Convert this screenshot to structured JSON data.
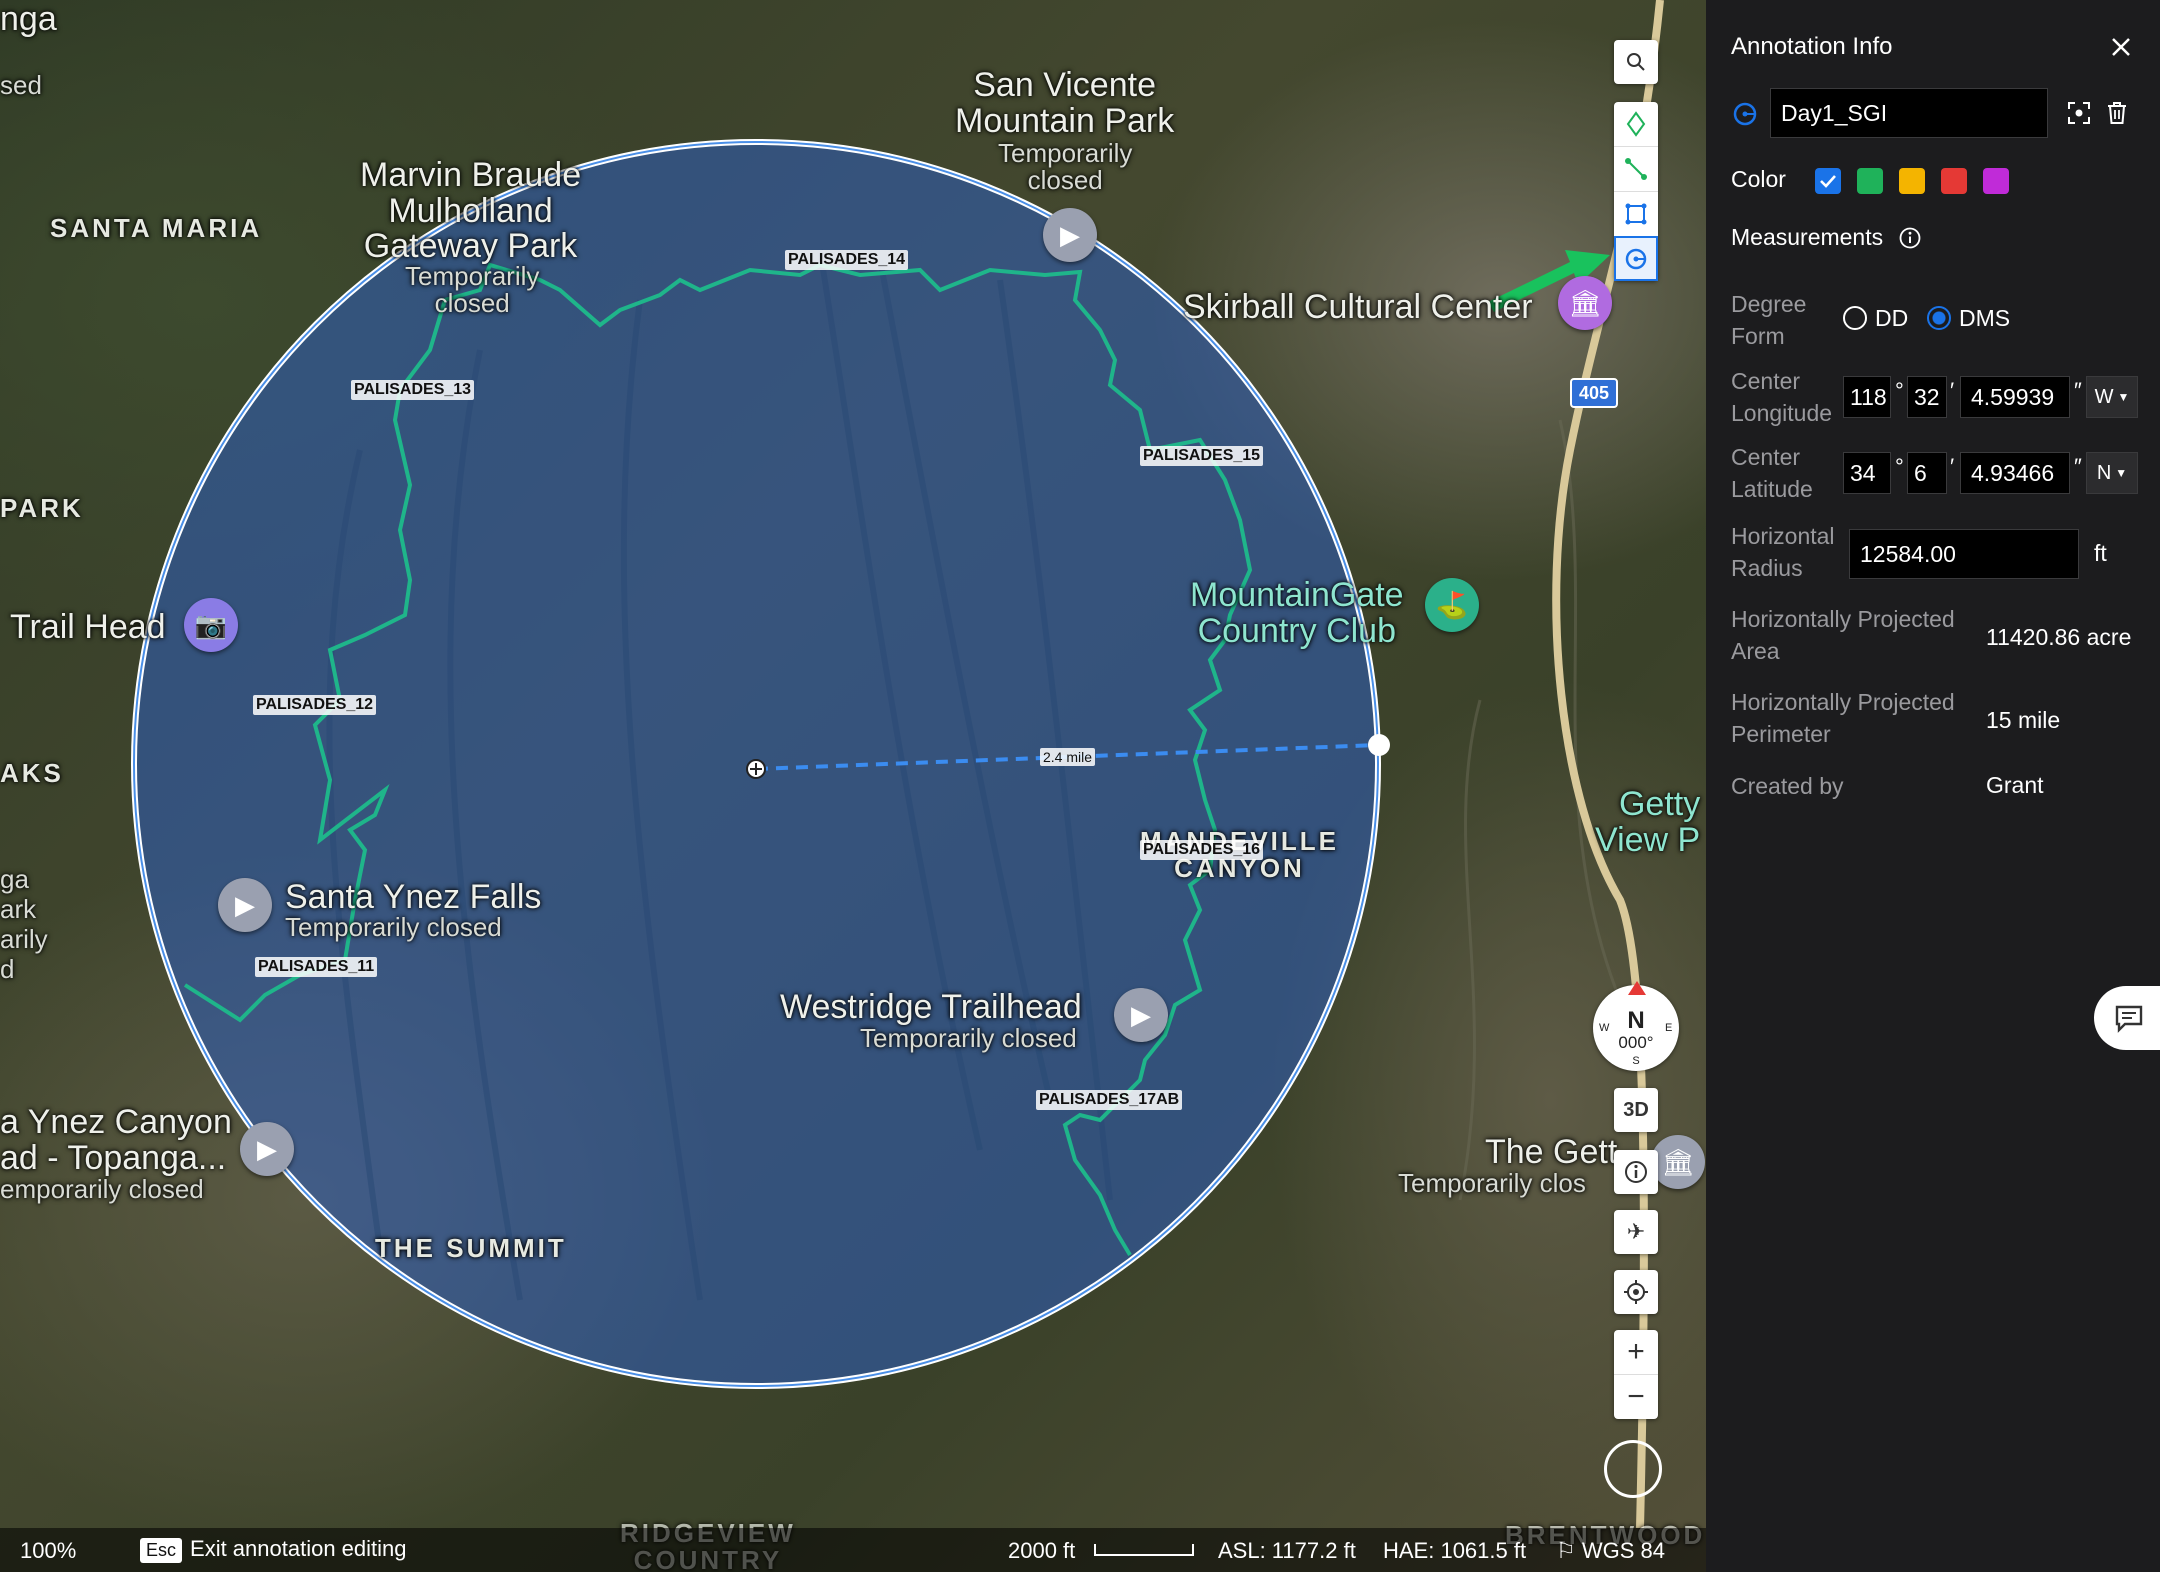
{
  "map": {
    "place_labels": {
      "san_vicente": "San Vicente\nMountain Park",
      "san_vicente_status": "Temporarily\nclosed",
      "marvin": "Marvin Braude\nMulholland\nGateway Park",
      "marvin_status": "Temporarily\nclosed",
      "santa_maria": "SANTA MARIA",
      "skirball": "Skirball Cultural Center",
      "park": "PARK",
      "trail_head": "Trail Head",
      "aks": "AKS",
      "mountaingate": "MountainGate\nCountry Club",
      "santa_ynez_falls": "Santa Ynez Falls",
      "santa_ynez_status": "Temporarily closed",
      "westridge": "Westridge Trailhead",
      "westridge_status": "Temporarily closed",
      "mandeville": "MANDEVILLE\nCANYON",
      "ynez_canyon": "a Ynez Canyon\nad - Topanga...",
      "ynez_canyon_status": "emporarily closed",
      "the_summit": "THE SUMMIT",
      "getty_view": "Getty\nView P",
      "the_getty": "The Gett",
      "the_getty_status": "Temporarily clos",
      "ridgeview": "RIDGEVIEW\nCOUNTRY",
      "nga": "nga",
      "sed": "sed",
      "ga_ark": "ga\nark\narily\nd",
      "hwy405": "405",
      "brentwood": "BRENTWOOD"
    },
    "markers": {
      "p11": "PALISADES_11",
      "p12": "PALISADES_12",
      "p13": "PALISADES_13",
      "p14": "PALISADES_14",
      "p15": "PALISADES_15",
      "p16": "PALISADES_16",
      "p17": "PALISADES_17AB"
    },
    "radius_label": "2.4 mile",
    "compass": {
      "n": "N",
      "deg": "000°",
      "s": "S",
      "e": "E",
      "w": "W"
    },
    "btn_3d": "3D"
  },
  "toolbar": {
    "tools": [
      "search-icon",
      "point-icon",
      "line-icon",
      "polygon-icon",
      "circle-icon"
    ]
  },
  "statusbar": {
    "zoom": "100%",
    "esc_key": "Esc",
    "exit_text": "Exit annotation editing",
    "scale": "2000 ft",
    "asl": "ASL: 1177.2 ft",
    "hae": "HAE: 1061.5 ft",
    "datum": "WGS 84"
  },
  "panel": {
    "title": "Annotation Info",
    "name_value": "Day1_SGI",
    "color_label": "Color",
    "colors": [
      "#1a73e8",
      "#1fb25a",
      "#f4b400",
      "#e53935",
      "#c02bd8"
    ],
    "measurements_label": "Measurements",
    "degree_form_label": "Degree\nForm",
    "dd_label": "DD",
    "dms_label": "DMS",
    "selected_form": "DMS",
    "center_longitude_label": "Center\nLongitude",
    "lon_deg": "118",
    "lon_min": "32",
    "lon_sec": "4.59939",
    "lon_dir": "W",
    "center_latitude_label": "Center\nLatitude",
    "lat_deg": "34",
    "lat_min": "6",
    "lat_sec": "4.93466",
    "lat_dir": "N",
    "horizontal_radius_label": "Horizontal\nRadius",
    "radius_value": "12584.00",
    "radius_unit": "ft",
    "area_label": "Horizontally Projected\nArea",
    "area_value": "11420.86 acre",
    "perimeter_label": "Horizontally Projected\nPerimeter",
    "perimeter_value": "15 mile",
    "created_by_label": "Created by",
    "created_by_value": "Grant"
  }
}
